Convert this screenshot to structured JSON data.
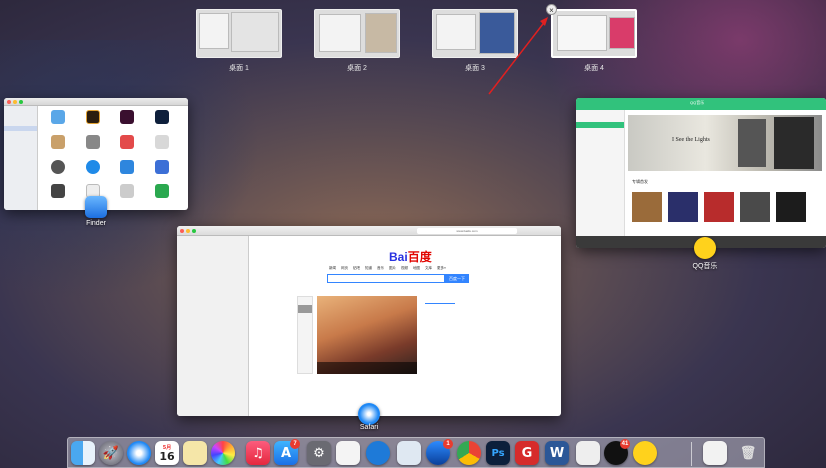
{
  "desktops": [
    {
      "label": "桌面 1"
    },
    {
      "label": "桌面 2"
    },
    {
      "label": "桌面 3"
    },
    {
      "label": "桌面 4"
    }
  ],
  "close_glyph": "×",
  "windows": {
    "finder": {
      "app_label": "Finder"
    },
    "qq_music": {
      "app_label": "QQ音乐",
      "title": "QQ音乐",
      "banner_text": "I See the Lights",
      "section": "专辑首发"
    },
    "safari": {
      "app_label": "Safari",
      "url": "www.baidu.com",
      "baidu_logo": "百度",
      "baidu_bai": "Bai",
      "search_button": "百度一下",
      "nav": [
        "新闻",
        "网页",
        "贴吧",
        "知道",
        "音乐",
        "图片",
        "视频",
        "地图",
        "文库",
        "更多»"
      ]
    }
  },
  "dock": {
    "calendar_day": "16",
    "calendar_month": "5月",
    "badges": {
      "app_store": "7",
      "qq": "41",
      "netease": "1"
    }
  },
  "colors": {
    "qq_green": "#31c27c",
    "baidu_blue": "#3385ff",
    "baidu_red": "#e10601",
    "arrow": "#e02020"
  }
}
